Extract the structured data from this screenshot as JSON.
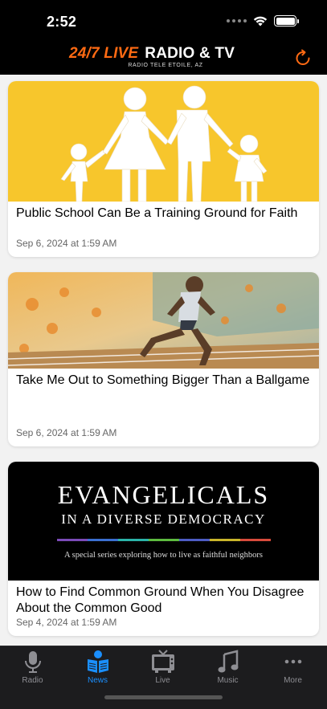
{
  "status_bar": {
    "time": "2:52"
  },
  "header": {
    "logo_live": "24/7 LIVE",
    "logo_radio": "RADIO & TV",
    "logo_sub": "RADIO TELE ETOILE, AZ"
  },
  "articles": [
    {
      "title": "Public School Can Be a Training Ground for Faith",
      "date": "Sep 6, 2024 at 1:59 AM"
    },
    {
      "title": "Take Me Out to Something Bigger Than a Ballgame",
      "date": "Sep 6, 2024 at 1:59 AM"
    },
    {
      "title": "How to Find Common Ground When You Disagree About the Common Good",
      "date": "Sep 4, 2024 at 1:59 AM",
      "image_heading1": "EVANGELICALS",
      "image_heading2": "IN A DIVERSE DEMOCRACY",
      "image_caption": "A special series exploring how to live as faithful neighbors"
    }
  ],
  "tabs": [
    {
      "label": "Radio",
      "icon": "microphone-icon"
    },
    {
      "label": "News",
      "icon": "newspaper-icon",
      "active": true
    },
    {
      "label": "Live",
      "icon": "tv-icon"
    },
    {
      "label": "Music",
      "icon": "music-note-icon"
    },
    {
      "label": "More",
      "icon": "more-dots-icon"
    }
  ],
  "colors": {
    "accent": "#ff6a13",
    "active_tab": "#1a8fff"
  }
}
